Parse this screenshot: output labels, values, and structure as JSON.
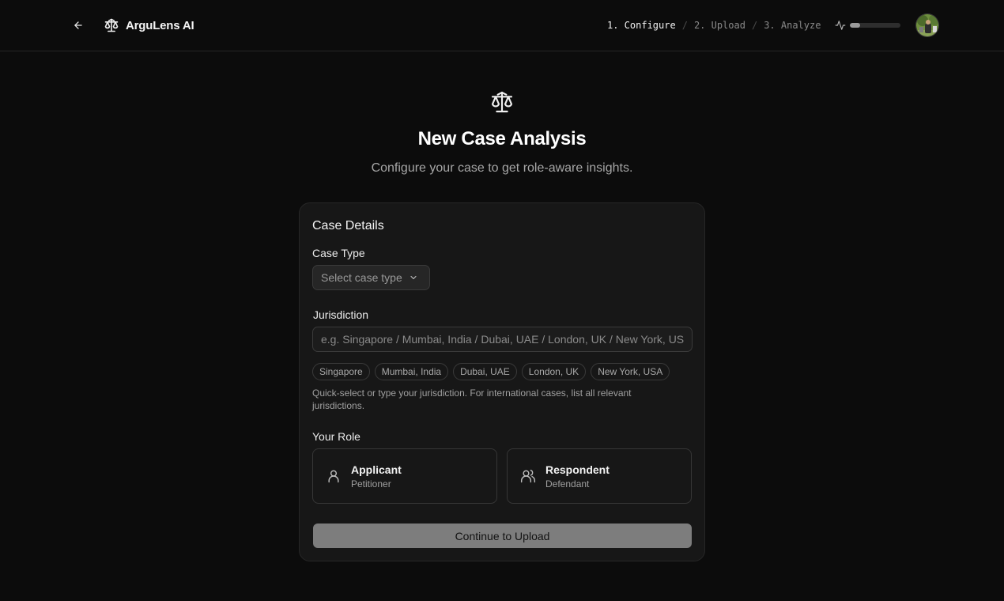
{
  "header": {
    "brand_name": "ArguLens AI",
    "steps": [
      "1. Configure",
      "2. Upload",
      "3. Analyze"
    ],
    "active_step": 0,
    "progress_fraction": 0.2,
    "icons": {
      "back": "arrow-left-icon",
      "brand": "scale-icon",
      "activity": "activity-icon"
    }
  },
  "hero": {
    "icon": "scale-icon",
    "title": "New Case Analysis",
    "subtitle": "Configure your case to get role-aware insights."
  },
  "form": {
    "card_title": "Case Details",
    "case_type": {
      "label": "Case Type",
      "placeholder": "Select case type"
    },
    "jurisdiction": {
      "label": "Jurisdiction",
      "placeholder": "e.g. Singapore / Mumbai, India / Dubai, UAE / London, UK / New York, USA",
      "value": "",
      "chips": [
        "Singapore",
        "Mumbai, India",
        "Dubai, UAE",
        "London, UK",
        "New York, USA"
      ],
      "hint": "Quick-select or type your jurisdiction. For international cases, list all relevant jurisdictions."
    },
    "role": {
      "label": "Your Role",
      "options": [
        {
          "name": "Applicant",
          "sub": "Petitioner",
          "icon": "user-icon"
        },
        {
          "name": "Respondent",
          "sub": "Defendant",
          "icon": "users-icon"
        }
      ]
    },
    "continue_label": "Continue to Upload"
  },
  "colors": {
    "background": "#0c0c0c",
    "card": "#171717",
    "border": "#272727",
    "button_disabled": "#7d7d7d"
  }
}
